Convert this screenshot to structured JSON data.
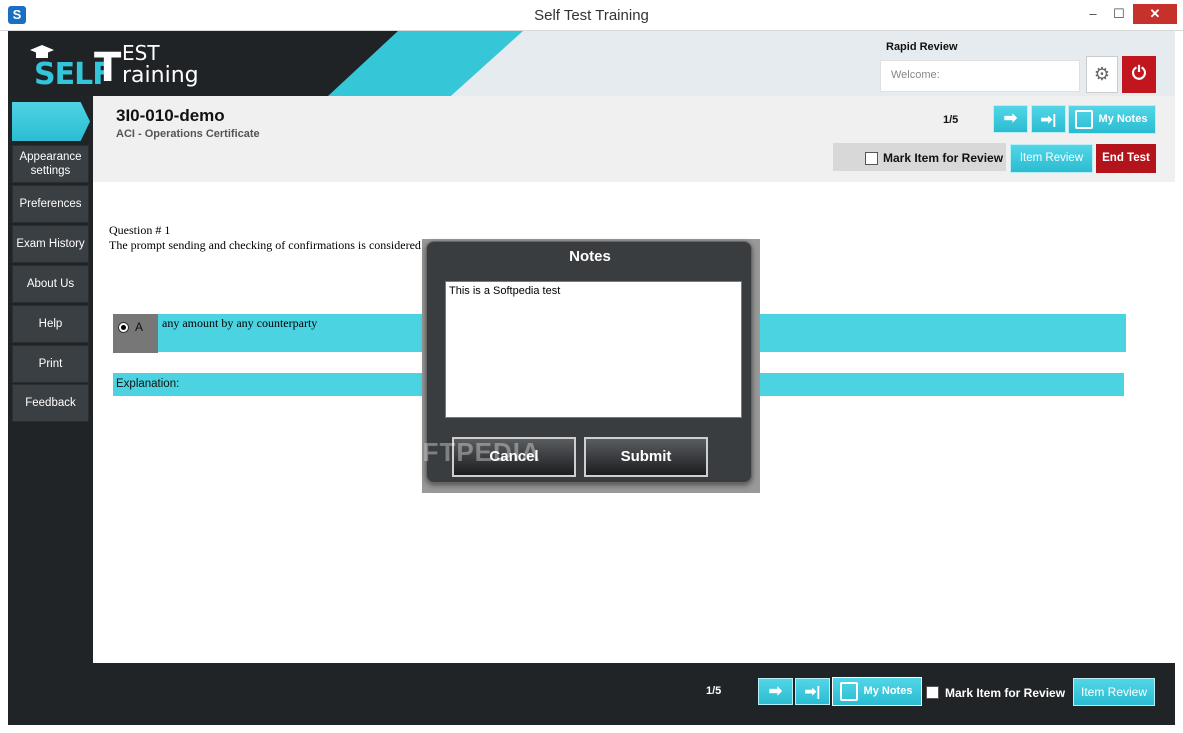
{
  "window": {
    "title": "Self Test Training",
    "min": "–",
    "max": "☐",
    "close": "✕"
  },
  "logo": {
    "self": "SELF",
    "t": "T",
    "est": "EST",
    "raining": "raining"
  },
  "header": {
    "rapid_review": "Rapid Review",
    "welcome": "Welcome:"
  },
  "sidebar": {
    "items": [
      {
        "label": "Appearance settings"
      },
      {
        "label": "Preferences"
      },
      {
        "label": "Exam History"
      },
      {
        "label": "About Us"
      },
      {
        "label": "Help"
      },
      {
        "label": "Print"
      },
      {
        "label": "Feedback"
      }
    ]
  },
  "exam": {
    "title": "3I0-010-demo",
    "subtitle": "ACI - Operations Certificate",
    "pager": "1/5",
    "my_notes": "My Notes",
    "mark_review": "Mark Item for Review",
    "item_review": "Item Review",
    "end_test": "End Test"
  },
  "question": {
    "number": "Question # 1",
    "text": "The prompt sending and checking of confirmations is considered"
  },
  "answers": [
    {
      "letter": "A",
      "text": "any amount by any counterparty"
    }
  ],
  "explanation": "Explanation:",
  "notes_dialog": {
    "title": "Notes",
    "text": "This is a Softpedia test",
    "cancel": "Cancel",
    "submit": "Submit"
  },
  "watermark": "SOFTPEDIA",
  "bottom": {
    "pager": "1/5",
    "my_notes": "My Notes",
    "mark_review": "Mark Item for Review",
    "item_review": "Item Review"
  },
  "colors": {
    "accent": "#35c6d8",
    "danger": "#b3141b",
    "dark": "#202427"
  }
}
